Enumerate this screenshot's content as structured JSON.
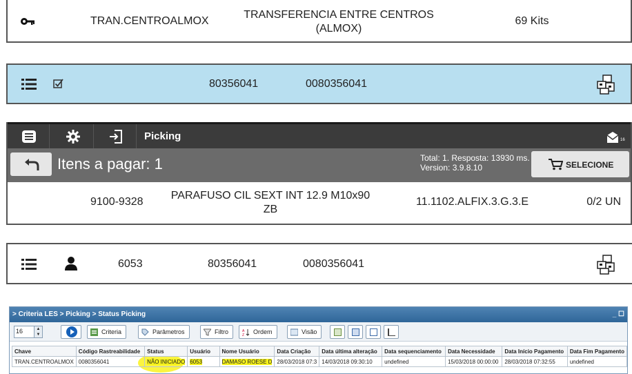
{
  "strip1": {
    "icon": "key-icon",
    "code": "TRAN.CENTROALMOX",
    "description": "TRANSFERENCIA ENTRE CENTROS (ALMOX)",
    "kits": "69 Kits"
  },
  "strip2": {
    "icons": [
      "list-icon",
      "checkbox-icon",
      "boxes-icon"
    ],
    "number": "80356041",
    "padded_number": "0080356041",
    "background": "#b8dff0"
  },
  "picking": {
    "icons": [
      "menu-icon",
      "gear-icon",
      "login-icon",
      "notification-icon"
    ],
    "title": "Picking",
    "badge": "16",
    "items_label": "Itens a pagar: 1",
    "total": "Total: 1. Resposta: 13930 ms.",
    "version": "Version: 3.9.8.10",
    "select_label": "SELECIONE",
    "row": {
      "code": "9100-9328",
      "description": "PARAFUSO CIL SEXT INT 12.9 M10x90 ZB",
      "location": "11.1102.ALFIX.3.G.3.E",
      "qty": "0/2 UN"
    }
  },
  "strip4": {
    "icons": [
      "list-icon",
      "user-icon",
      "boxes-icon"
    ],
    "user_id": "6053",
    "number": "80356041",
    "padded_number": "0080356041"
  },
  "window": {
    "breadcrumb": "> Criteria LES > Picking > Status Picking",
    "controls": "_ ☐",
    "page_size": "16",
    "buttons": {
      "criteria": "Criteria",
      "parametros": "Parâmetros",
      "filtro": "Filtro",
      "ordem": "Ordem",
      "visao": "Visão"
    },
    "columns": [
      "Chave",
      "Código Rastreabilidade",
      "Status",
      "Usuário",
      "Nome Usuário",
      "Data Criação",
      "Data última alteração",
      "Data sequenciamento",
      "Data Necessidade",
      "Data Início Pagamento",
      "Data Fim Pagamento"
    ],
    "row": [
      "TRAN.CENTROALMOX",
      "0080356041",
      "NÃO INICIADO",
      "6053",
      "DAMASO ROESE D",
      "28/03/2018 07:3",
      "14/03/2018 09:30:10",
      "undefined",
      "15/03/2018 00:00:00",
      "28/03/2018 07:32:55",
      "undefined"
    ],
    "highlight_color": "#f6f21b"
  }
}
